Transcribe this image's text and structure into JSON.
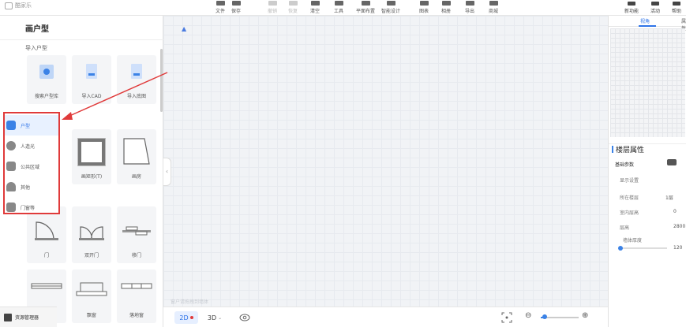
{
  "app": {
    "logo_text": "酷家乐"
  },
  "toolbar": {
    "items": [
      {
        "label": "文件",
        "faded": false
      },
      {
        "label": "保存",
        "faded": false
      },
      {
        "label": "撤销",
        "faded": true
      },
      {
        "label": "恢复",
        "faded": true
      },
      {
        "label": "清空",
        "faded": false
      },
      {
        "label": "工具",
        "faded": false
      },
      {
        "label": "平面布置",
        "faded": false
      },
      {
        "label": "智能设计",
        "faded": false
      },
      {
        "label": "图表",
        "faded": false
      },
      {
        "label": "相册",
        "faded": false
      },
      {
        "label": "导出",
        "faded": false
      },
      {
        "label": "商城",
        "faded": false
      }
    ],
    "right_items": [
      {
        "label": "新功能"
      },
      {
        "label": "活动"
      },
      {
        "label": "帮助"
      }
    ]
  },
  "left_panel": {
    "title": "画户型",
    "import_label": "导入户型",
    "import_cards": [
      {
        "label": "搜索户型库",
        "icon": "search-floorplan-icon"
      },
      {
        "label": "导入CAD",
        "icon": "cad-file-icon"
      },
      {
        "label": "导入底图",
        "icon": "image-file-icon"
      }
    ],
    "categories": [
      {
        "label": "户型",
        "icon": "floorplan-icon",
        "active": true
      },
      {
        "label": "人造光",
        "icon": "lightbulb-icon",
        "active": false
      },
      {
        "label": "公共区域",
        "icon": "furniture-icon",
        "active": false
      },
      {
        "label": "其他",
        "icon": "person-icon",
        "active": false
      },
      {
        "label": "门窗等",
        "icon": "door-window-icon",
        "active": false
      }
    ],
    "room_cards": [
      {
        "label": "画矩形(T)",
        "icon": "rect-room-icon"
      },
      {
        "label": "画房",
        "icon": "polygon-room-icon"
      }
    ],
    "door_cards": [
      {
        "label": "门",
        "icon": "single-door-icon"
      },
      {
        "label": "双开门",
        "icon": "double-door-icon"
      },
      {
        "label": "移门",
        "icon": "sliding-door-icon"
      }
    ],
    "window_cards": [
      {
        "label": "",
        "icon": "window-icon"
      },
      {
        "label": "飘窗",
        "icon": "bay-window-icon"
      },
      {
        "label": "落地窗",
        "icon": "floor-window-icon"
      }
    ],
    "assets_label": "资源管理器"
  },
  "canvas": {
    "watermark": "窗户请拖拽到墙体"
  },
  "bottom_bar": {
    "btn_2d": "2D",
    "btn_3d": "3D",
    "zoom_fraction": 0.1
  },
  "right_panel": {
    "tabs": [
      "视角",
      "属性"
    ],
    "active_tab": 0,
    "props_title": "楼层属性",
    "props_subtitle": "基础参数",
    "rows": [
      {
        "label": "显示设置",
        "value": ""
      },
      {
        "label": "所在楼层",
        "value": "1层"
      },
      {
        "label": "室内层高",
        "value": "0"
      },
      {
        "label": "层高",
        "value": "2800"
      },
      {
        "label": "墙体厚度",
        "value": "120"
      }
    ]
  },
  "colors": {
    "accent": "#3b82e6",
    "annotation_red": "#e03a3a",
    "canvas_bg": "#f1f3f6"
  }
}
